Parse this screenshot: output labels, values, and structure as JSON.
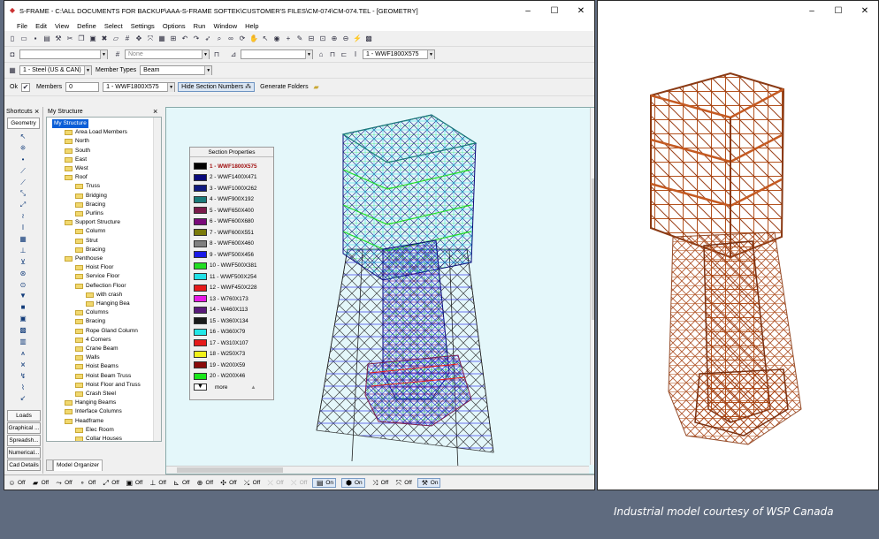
{
  "window": {
    "title": "S-FRAME - C:\\ALL DOCUMENTS FOR BACKUP\\AAA-S-FRAME SOFTEK\\CUSTOMER'S FILES\\CM-074\\CM-074.TEL - [GEOMETRY]",
    "minimize_icon": "minimize-icon",
    "maximize_icon": "maximize-icon",
    "close_icon": "close-icon"
  },
  "menu": [
    "File",
    "Edit",
    "View",
    "Define",
    "Select",
    "Settings",
    "Options",
    "Run",
    "Window",
    "Help"
  ],
  "toolbar2": {
    "plane_value": "None",
    "section_value": "1 - WWF1800X575"
  },
  "toolbar3": {
    "material_value": "1 - Steel (US & CAN)",
    "member_types_label": "Member Types",
    "member_type_value": "Beam"
  },
  "toolbar4": {
    "ok_label": "Ok",
    "members_label": "Members",
    "members_value": "0",
    "section_value": "1 - WWF1800X575",
    "hide_section_numbers_label": "Hide Section Numbers",
    "generate_folders_label": "Generate Folders"
  },
  "shortcuts": {
    "title": "Shortcuts",
    "close": "×",
    "geometry_label": "Geometry",
    "bottom_buttons": [
      "Loads",
      "Graphical ...",
      "Spreadsh...",
      "Numerical...",
      "Cad Details"
    ]
  },
  "structure": {
    "title": "My Structure",
    "close": "×",
    "tree": [
      {
        "label": "My Structure",
        "depth": 0,
        "root": true
      },
      {
        "label": "Area Load Members",
        "depth": 1
      },
      {
        "label": "North",
        "depth": 1
      },
      {
        "label": "South",
        "depth": 1
      },
      {
        "label": "East",
        "depth": 1
      },
      {
        "label": "West",
        "depth": 1
      },
      {
        "label": "Roof",
        "depth": 1
      },
      {
        "label": "Truss",
        "depth": 2
      },
      {
        "label": "Bridging",
        "depth": 2
      },
      {
        "label": "Bracing",
        "depth": 2
      },
      {
        "label": "Purlins",
        "depth": 2
      },
      {
        "label": "Support Structure",
        "depth": 1
      },
      {
        "label": "Column",
        "depth": 2
      },
      {
        "label": "Strut",
        "depth": 2
      },
      {
        "label": "Bracing",
        "depth": 2
      },
      {
        "label": "Penthouse",
        "depth": 1
      },
      {
        "label": "Hoist Floor",
        "depth": 2
      },
      {
        "label": "Service Floor",
        "depth": 2
      },
      {
        "label": "Deflection Floor",
        "depth": 2
      },
      {
        "label": "with crash",
        "depth": 3
      },
      {
        "label": "Hanging Bea",
        "depth": 3
      },
      {
        "label": "Columns",
        "depth": 2
      },
      {
        "label": "Bracing",
        "depth": 2
      },
      {
        "label": "Rope Gland Column",
        "depth": 2
      },
      {
        "label": "4 Corners",
        "depth": 2
      },
      {
        "label": "Crane Beam",
        "depth": 2
      },
      {
        "label": "Walls",
        "depth": 2
      },
      {
        "label": "Hoist Beams",
        "depth": 2
      },
      {
        "label": "Hoist Beam Truss",
        "depth": 2
      },
      {
        "label": "Hoist Floor and Truss",
        "depth": 2
      },
      {
        "label": "Crash Steel",
        "depth": 2
      },
      {
        "label": "Hanging Beams",
        "depth": 1
      },
      {
        "label": "Interface Columns",
        "depth": 1
      },
      {
        "label": "Headframe",
        "depth": 1
      },
      {
        "label": "Elec Room",
        "depth": 2
      },
      {
        "label": "Collar Houses",
        "depth": 2
      }
    ],
    "tab_label": "Model Organizer"
  },
  "section_properties": {
    "title": "Section Properties",
    "items": [
      {
        "label": "1 - WWF1800X575",
        "color": "#000000",
        "selected": true
      },
      {
        "label": "2 - WWF1400X471",
        "color": "#0a0a7a"
      },
      {
        "label": "3 - WWF1000X262",
        "color": "#101a80"
      },
      {
        "label": "4 - WWF900X192",
        "color": "#1a7a7a"
      },
      {
        "label": "5 - WWF650X400",
        "color": "#7a1a4a"
      },
      {
        "label": "6 - WWF600X680",
        "color": "#7a0a7a"
      },
      {
        "label": "7 - WWF600X551",
        "color": "#7a7a0a"
      },
      {
        "label": "8 - WWF600X460",
        "color": "#808080"
      },
      {
        "label": "9 - WWF500X456",
        "color": "#1a1ae6"
      },
      {
        "label": "10 - WWF500X381",
        "color": "#22dd22"
      },
      {
        "label": "11 - WWF500X254",
        "color": "#22e0e6"
      },
      {
        "label": "12 - WWF450X228",
        "color": "#e61a1a"
      },
      {
        "label": "13 - W760X173",
        "color": "#e61ae6"
      },
      {
        "label": "14 - W460X113",
        "color": "#5a1a7a"
      },
      {
        "label": "15 - W360X134",
        "color": "#1a1a1a"
      },
      {
        "label": "16 - W360X79",
        "color": "#22e6e6"
      },
      {
        "label": "17 - W310X107",
        "color": "#e61a1a"
      },
      {
        "label": "18 - W250X73",
        "color": "#f0f01a"
      },
      {
        "label": "19 - W200X59",
        "color": "#8a0a0a"
      },
      {
        "label": "20 - W200X46",
        "color": "#1ae61a"
      }
    ],
    "more_label": "more"
  },
  "status": [
    {
      "icon": "smiley-icon",
      "glyph": "☺",
      "label": "Off"
    },
    {
      "icon": "node-number-icon",
      "glyph": "▰",
      "label": "Off"
    },
    {
      "icon": "member-number-icon",
      "glyph": "⤳",
      "label": "Off"
    },
    {
      "icon": "joint-icon",
      "glyph": "∘",
      "label": "Off"
    },
    {
      "icon": "release-icon",
      "glyph": "⤢",
      "label": "Off"
    },
    {
      "icon": "section-icon",
      "glyph": "▣",
      "label": "Off"
    },
    {
      "icon": "support-icon",
      "glyph": "⊥",
      "label": "Off"
    },
    {
      "icon": "spring-icon",
      "glyph": "⊾",
      "label": "Off"
    },
    {
      "icon": "load-icon",
      "glyph": "⊕",
      "label": "Off"
    },
    {
      "icon": "local-axis-icon",
      "glyph": "✣",
      "label": "Off"
    },
    {
      "icon": "rigid-link-icon",
      "glyph": "⤯",
      "label": "Off"
    },
    {
      "icon": "offset-icon",
      "glyph": "⤫",
      "label": "Off",
      "dim": true
    },
    {
      "icon": "panel-icon",
      "glyph": "⤬",
      "label": "Off",
      "dim": true
    },
    {
      "icon": "color-section-icon",
      "glyph": "▤",
      "label": "On",
      "on": true
    },
    {
      "icon": "render-icon",
      "glyph": "⬢",
      "label": "On",
      "on": true
    },
    {
      "icon": "label-icon",
      "glyph": "⤨",
      "label": "Off"
    },
    {
      "icon": "dimension-icon",
      "glyph": "⤧",
      "label": "Off"
    },
    {
      "icon": "hide-icon",
      "glyph": "⚒",
      "label": "On",
      "on": true
    }
  ],
  "viewer": {
    "minimize_icon": "minimize-icon",
    "maximize_icon": "maximize-icon",
    "close_icon": "close-icon"
  },
  "caption": "Industrial model courtesy of WSP Canada"
}
